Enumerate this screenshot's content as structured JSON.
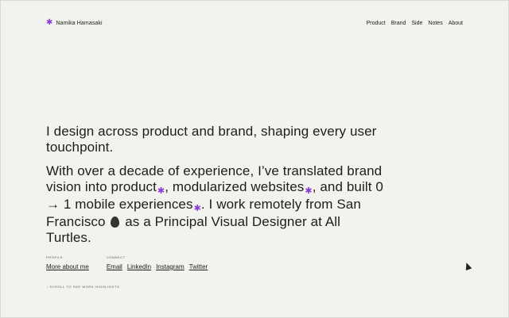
{
  "header": {
    "brand_name": "Namika Hamasaki",
    "brand_icon": "asterisk-icon",
    "accent_color": "#8a3dd6",
    "nav": [
      "Product",
      "Brand",
      "Side",
      "Notes",
      "About"
    ]
  },
  "hero": {
    "line1": "I design across product and brand, shaping every user touchpoint.",
    "p2_part1": "With over a decade of experience, I’ve translated brand vision into product",
    "p2_part2": ", modularized websites",
    "p2_part3": ", and built 0 → 1 mobile experiences",
    "p2_part4": ". I work remotely from San Francisco",
    "p2_part5": " as a Principal Visual Designer at All Turtles.",
    "inline_icon": "asterisk-icon",
    "location_icon": "leaf-icon"
  },
  "profile": {
    "label": "Profile",
    "link": "More about me"
  },
  "connect": {
    "label": "Connect",
    "links": [
      "Email",
      "LinkedIn",
      "Instagram",
      "Twitter"
    ]
  },
  "scroll_hint": "↓ Scroll to see work highlights"
}
